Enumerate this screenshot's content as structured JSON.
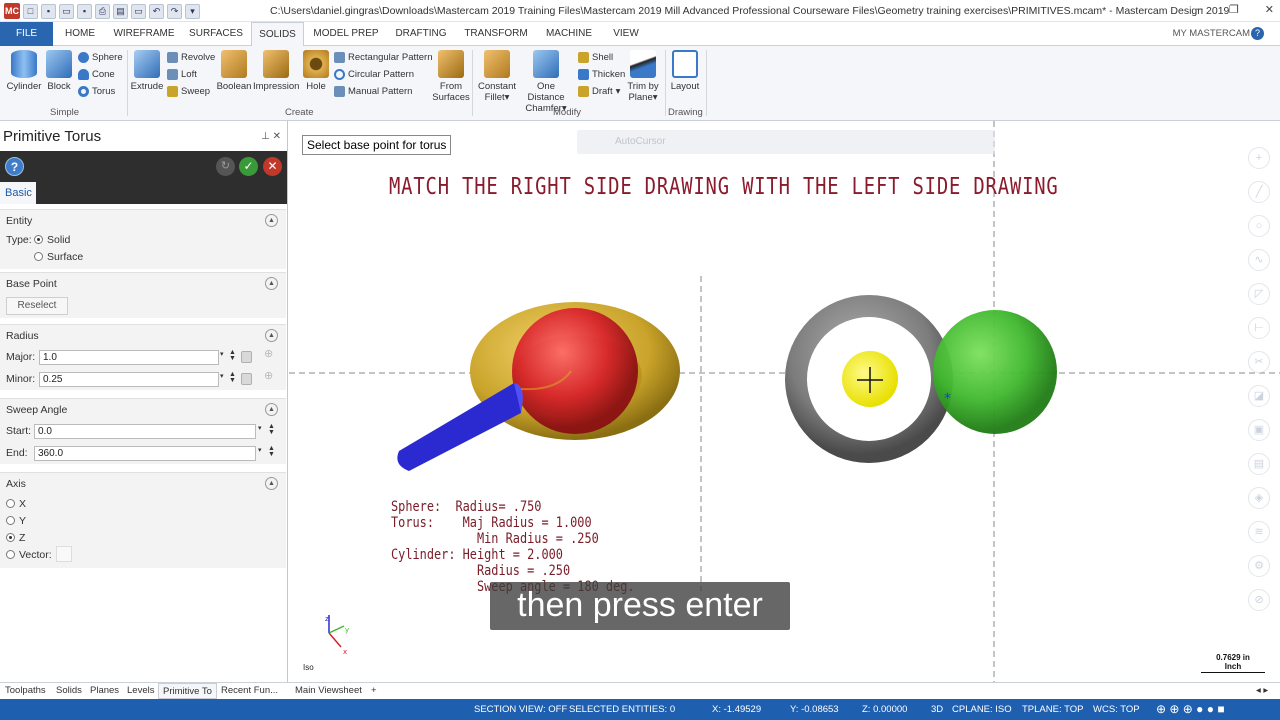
{
  "window": {
    "title": "C:\\Users\\daniel.gingras\\Downloads\\Mastercam 2019 Training Files\\Mastercam 2019 Mill Advanced Professional Courseware Files\\Geometry training exercises\\PRIMITIVES.mcam* - Mastercam Design 2019",
    "app_icon": "MC"
  },
  "ribbon_tabs": [
    "FILE",
    "HOME",
    "WIREFRAME",
    "SURFACES",
    "SOLIDS",
    "MODEL PREP",
    "DRAFTING",
    "TRANSFORM",
    "MACHINE",
    "VIEW"
  ],
  "active_tab": "SOLIDS",
  "my_mastercam": "MY MASTERCAM",
  "ribbon": {
    "simple": {
      "label": "Simple",
      "cylinder": "Cylinder",
      "block": "Block",
      "sphere": "Sphere",
      "cone": "Cone",
      "torus": "Torus"
    },
    "create": {
      "label": "Create",
      "extrude": "Extrude",
      "revolve": "Revolve",
      "loft": "Loft",
      "sweep": "Sweep",
      "boolean": "Boolean",
      "impression": "Impression",
      "hole": "Hole",
      "rect_pattern": "Rectangular Pattern",
      "circ_pattern": "Circular Pattern",
      "manual_pattern": "Manual Pattern",
      "from_surfaces_1": "From",
      "from_surfaces_2": "Surfaces"
    },
    "modify": {
      "label": "Modify",
      "constant_fillet_1": "Constant",
      "constant_fillet_2": "Fillet",
      "one_distance_1": "One Distance",
      "one_distance_2": "Chamfer",
      "shell": "Shell",
      "thicken": "Thicken",
      "draft": "Draft",
      "trim_by_plane_1": "Trim by",
      "trim_by_plane_2": "Plane"
    },
    "drawing": {
      "label": "Drawing",
      "layout": "Layout"
    }
  },
  "panel": {
    "title": "Primitive Torus",
    "tab": "Basic",
    "entity": {
      "header": "Entity",
      "type_label": "Type:",
      "solid": "Solid",
      "surface": "Surface",
      "selected": "Solid"
    },
    "base_point": {
      "header": "Base Point",
      "reselect": "Reselect"
    },
    "radius": {
      "header": "Radius",
      "major_label": "Major:",
      "major_value": "1.0",
      "minor_label": "Minor:",
      "minor_value": "0.25"
    },
    "sweep_angle": {
      "header": "Sweep Angle",
      "start_label": "Start:",
      "start_value": "0.0",
      "end_label": "End:",
      "end_value": "360.0"
    },
    "axis": {
      "header": "Axis",
      "x": "X",
      "y": "Y",
      "z": "Z",
      "vector": "Vector:",
      "selected": "Z"
    }
  },
  "viewport": {
    "prompt": "Select base point for torus",
    "autocursor": "AutoCursor",
    "heading": "MATCH THE RIGHT SIDE DRAWING WITH THE LEFT SIDE DRAWING",
    "notes": [
      "Sphere:  Radius= .750",
      "Torus:    Maj Radius = 1.000",
      "            Min Radius = .250",
      "Cylinder: Height = 2.000",
      "            Radius = .250",
      "            Sweep angle = 180 deg."
    ],
    "caption": "then press enter",
    "view_label": "Iso",
    "scale_value": "0.7629 in",
    "scale_unit": "Inch",
    "colors": {
      "torus_gold": "#c9a32a",
      "sphere_red": "#d8202a",
      "cylinder_blue": "#2a2ad0",
      "torus_gray": "#7c7c7c",
      "sphere_green": "#3fb82e",
      "base_point": "#f3f000"
    }
  },
  "bottom_tabs": [
    "Toolpaths",
    "Solids",
    "Planes",
    "Levels",
    "Primitive To",
    "Recent Fun..."
  ],
  "viewsheet": "Main Viewsheet",
  "add_viewsheet": "+",
  "status": {
    "section_view": "SECTION VIEW: OFF",
    "selected": "SELECTED ENTITIES: 0",
    "x": "X:   -1.49529",
    "y": "Y:   -0.08653",
    "z": "Z:  0.00000",
    "mode": "3D",
    "cplane": "CPLANE: ISO",
    "tplane": "TPLANE: TOP",
    "wcs": "WCS: TOP"
  }
}
